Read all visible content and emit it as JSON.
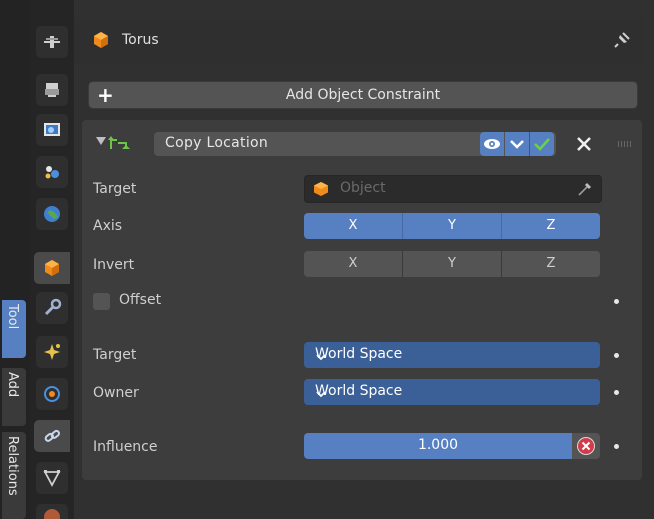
{
  "left_tabs": {
    "tool": "Tool",
    "add": "Add",
    "relations": "Relations"
  },
  "header": {
    "title": "Torus"
  },
  "add_constraint": {
    "label": "Add Object Constraint"
  },
  "constraint": {
    "name": "Copy Location",
    "target": {
      "label": "Target",
      "placeholder": "Object"
    },
    "axis": {
      "label": "Axis",
      "options": [
        "X",
        "Y",
        "Z"
      ]
    },
    "invert": {
      "label": "Invert",
      "options": [
        "X",
        "Y",
        "Z"
      ]
    },
    "offset": {
      "label": "Offset",
      "checked": false
    },
    "target_space": {
      "label": "Target",
      "value": "World Space"
    },
    "owner_space": {
      "label": "Owner",
      "value": "World Space"
    },
    "influence": {
      "label": "Influence",
      "value": "1.000"
    }
  },
  "colors": {
    "accent": "#5680c2",
    "panel": "#3d3d3d",
    "background": "#303030"
  },
  "icons": [
    "tool-icon",
    "render-icon",
    "output-icon",
    "view-layer-icon",
    "world-icon",
    "object-icon",
    "modifier-icon",
    "particles-icon",
    "physics-icon",
    "constraint-icon",
    "data-icon",
    "material-icon",
    "pin-icon",
    "eye-icon",
    "checkmark-icon",
    "close-icon",
    "eyedropper-icon"
  ]
}
